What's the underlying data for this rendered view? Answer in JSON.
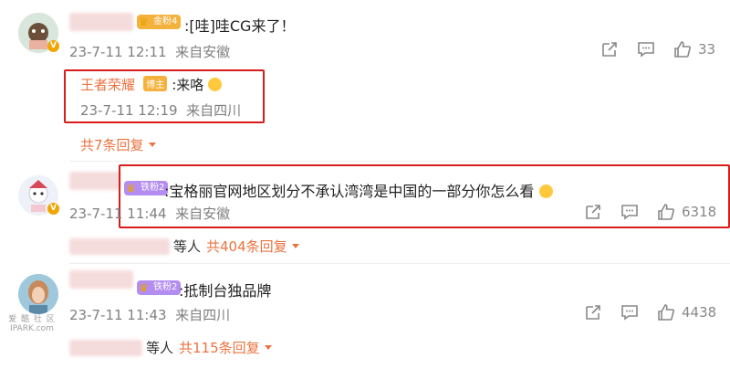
{
  "comments": [
    {
      "fan_badge": "金粉4",
      "text": ":[哇]哇CG来了！",
      "time": "23-7-11 12:11",
      "location": "来自安徽",
      "likes": "33",
      "reply": {
        "author": "王者荣耀",
        "author_badge": "博主",
        "text": ":来咯",
        "time": "23-7-11 12:19",
        "location": "来自四川"
      },
      "more_replies": "共7条回复"
    },
    {
      "fan_badge": "铁粉2",
      "text": ":宝格丽官网地区划分不承认湾湾是中国的一部分你怎么看",
      "time": "23-7-11 11:44",
      "location": "来自安徽",
      "likes": "6318",
      "replies_prefix": "等人",
      "more_replies": "共404条回复"
    },
    {
      "fan_badge": "铁粉2",
      "text": ":抵制台独品牌",
      "time": "23-7-11 11:43",
      "location": "来自四川",
      "likes": "4438",
      "replies_prefix": "等人",
      "more_replies": "共115条回复"
    }
  ],
  "watermark": {
    "line1": "爱 酷 社 区",
    "line2": "IPARK.com"
  },
  "colors": {
    "accent": "#eb7340",
    "highlight_box": "#d81b1b",
    "author": "#eb7340"
  },
  "icons": [
    "share-icon",
    "comment-icon",
    "like-icon",
    "chevron-down-icon",
    "verified-badge-icon",
    "emoji-icon"
  ]
}
